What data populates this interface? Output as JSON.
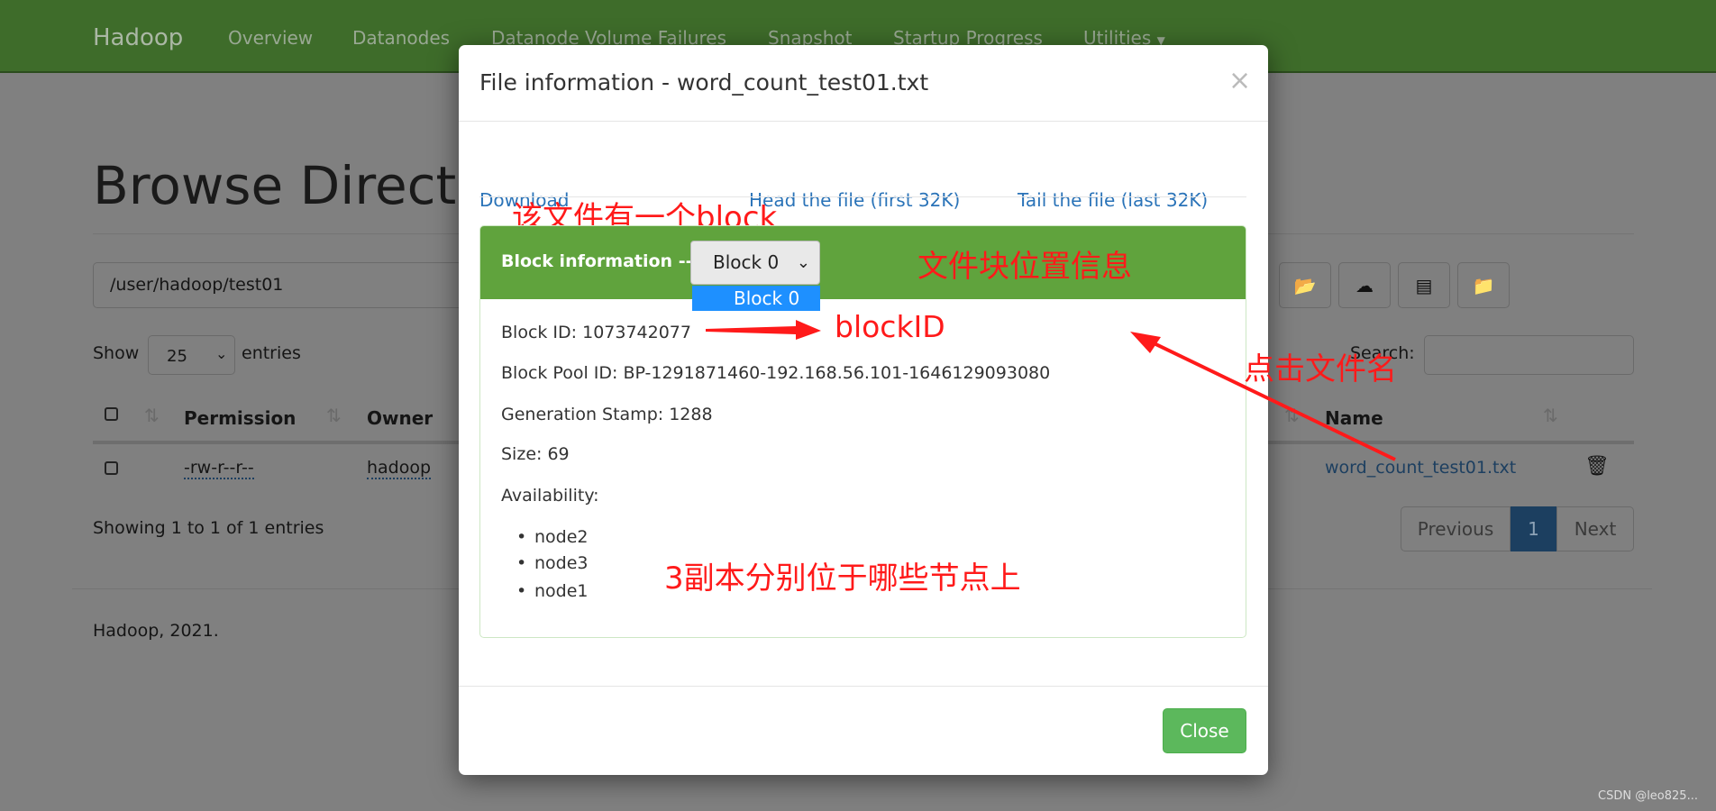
{
  "navbar": {
    "brand": "Hadoop",
    "items": [
      "Overview",
      "Datanodes",
      "Datanode Volume Failures",
      "Snapshot",
      "Startup Progress",
      "Utilities"
    ]
  },
  "page": {
    "title": "Browse Directory",
    "path": "/user/hadoop/test01",
    "show_label": "Show",
    "entries_value": "25",
    "entries_label": "entries",
    "search_label": "Search:",
    "search_value": "",
    "columns": [
      "Permission",
      "Owner",
      "Name"
    ],
    "rows": [
      {
        "permission": "-rw-r--r--",
        "owner": "hadoop",
        "name": "word_count_test01.txt"
      }
    ],
    "info": "Showing 1 to 1 of 1 entries",
    "pagination": {
      "previous": "Previous",
      "current": "1",
      "next": "Next"
    },
    "footer": "Hadoop, 2021."
  },
  "modal": {
    "title": "File information - word_count_test01.txt",
    "close_x": "×",
    "download": "Download",
    "head": "Head the file (first 32K)",
    "tail": "Tail the file (last 32K)",
    "block_info_label": "Block information --",
    "block_select": "Block 0",
    "block_options": [
      "Block 0"
    ],
    "block_id": "Block ID: 1073742077",
    "block_pool_id": "Block Pool ID: BP-1291871460-192.168.56.101-1646129093080",
    "generation_stamp": "Generation Stamp: 1288",
    "size": "Size: 69",
    "availability": "Availability:",
    "nodes": [
      "node2",
      "node3",
      "node1"
    ],
    "close_button": "Close"
  },
  "annotations": {
    "one_block": "该文件有一个block",
    "block_location": "文件块位置信息",
    "block_id": "blockID",
    "click_filename": "点击文件名",
    "replicas": "3副本分别位于哪些节点上",
    "color": "#ff1a1a"
  },
  "watermark": "CSDN @leo825..."
}
